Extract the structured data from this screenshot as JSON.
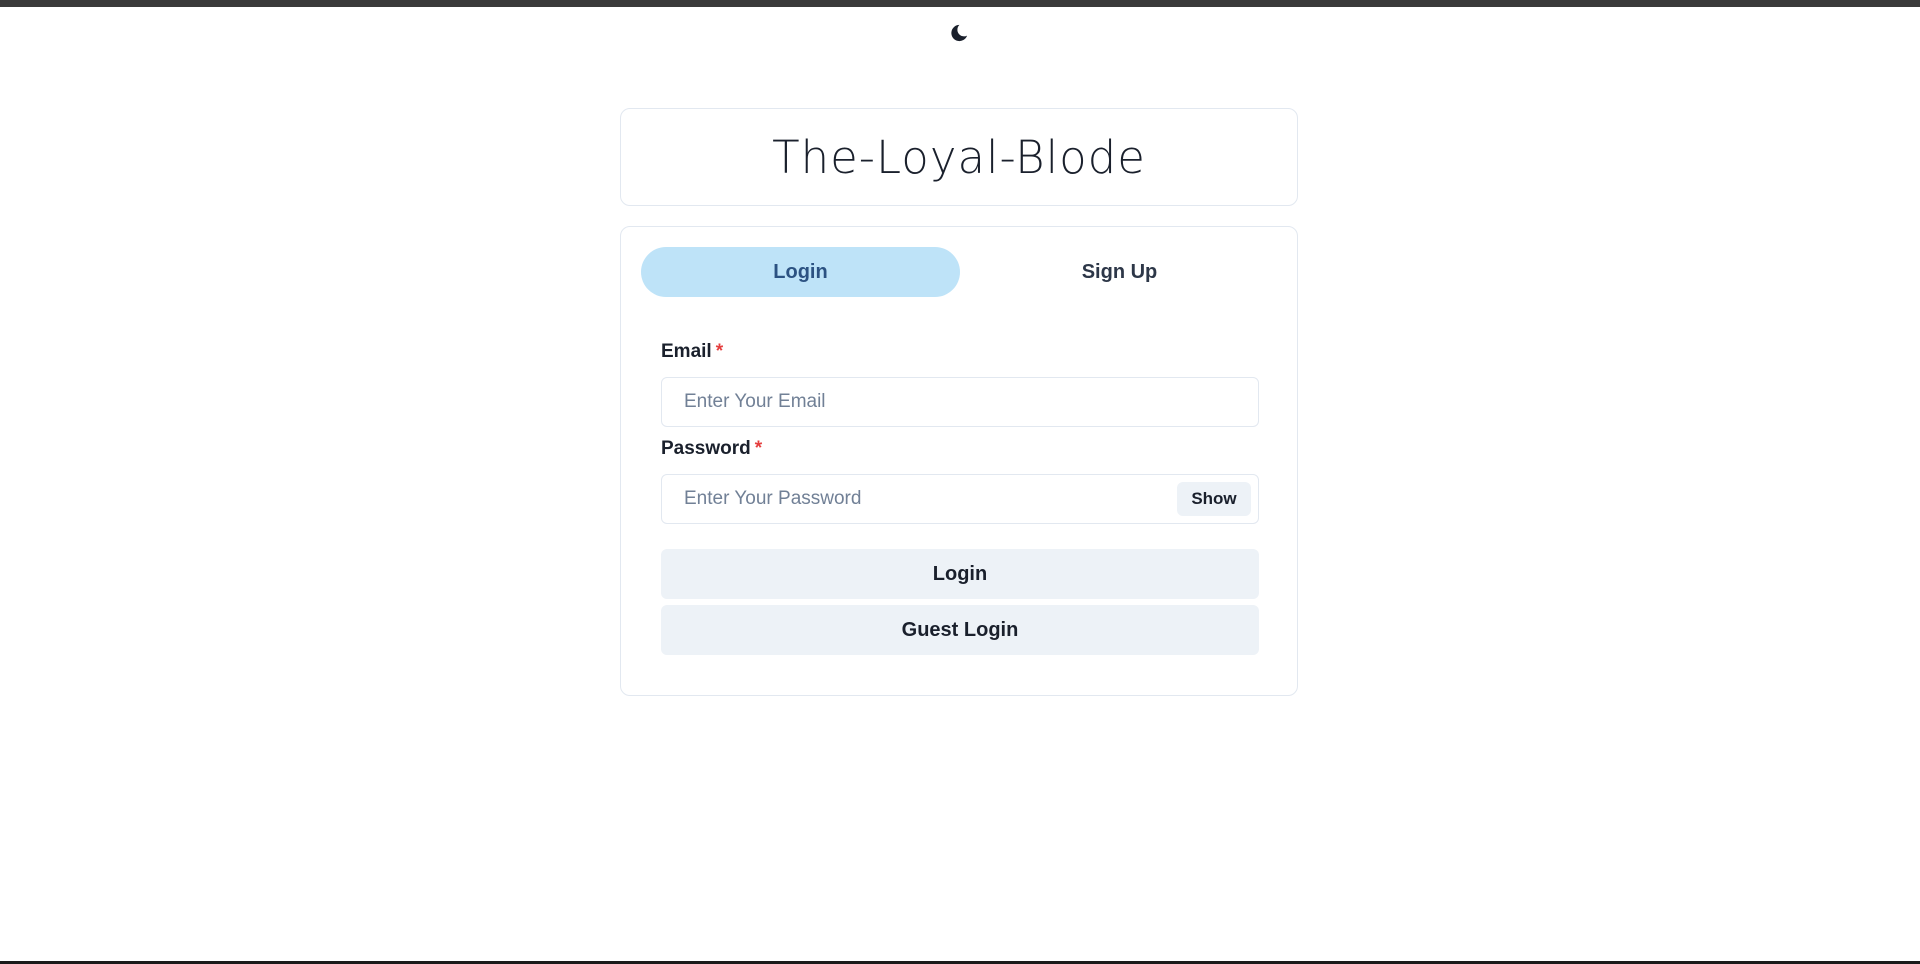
{
  "app": {
    "title": "The-Loyal-Blode",
    "theme_toggle_icon": "moon-icon"
  },
  "tabs": [
    {
      "label": "Login",
      "active": true
    },
    {
      "label": "Sign Up",
      "active": false
    }
  ],
  "form": {
    "email_label": "Email",
    "email_placeholder": "Enter Your Email",
    "password_label": "Password",
    "password_placeholder": "Enter Your Password",
    "required_mark": "*",
    "show_label": "Show",
    "login_button": "Login",
    "guest_login_button": "Guest Login"
  },
  "colors": {
    "active_tab_bg": "#bee3f8",
    "button_bg": "#edf2f7",
    "required": "#e53e3e",
    "border": "#e2e8f0"
  }
}
